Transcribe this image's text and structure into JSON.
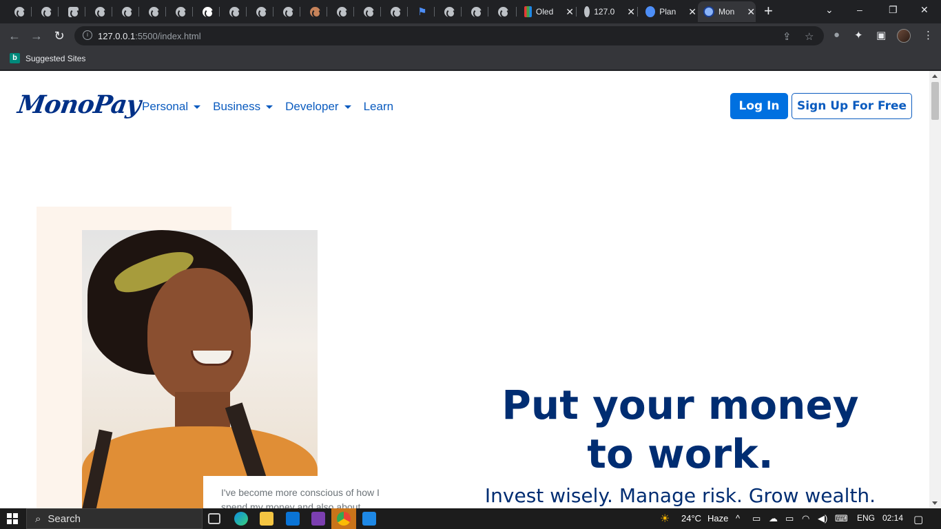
{
  "browser": {
    "tabs_wide": [
      {
        "label": "Oled",
        "close": "✕"
      },
      {
        "label": "127.0",
        "close": "✕"
      },
      {
        "label": "Plan",
        "close": "✕"
      },
      {
        "label": "Mon",
        "close": "✕",
        "active": true
      }
    ],
    "new_tab": "+",
    "window_controls": {
      "minimize": "–",
      "restore": "❐",
      "close": "✕",
      "tab_search": "⌄"
    },
    "url_host": "127.0.0.1",
    "url_path": ":5500/index.html",
    "bookmark": "Suggested Sites"
  },
  "site": {
    "logo": "MonoPay",
    "nav": [
      {
        "label": "Personal",
        "dropdown": true
      },
      {
        "label": "Business",
        "dropdown": true
      },
      {
        "label": "Developer",
        "dropdown": true
      },
      {
        "label": "Learn",
        "dropdown": false
      }
    ],
    "login_label": "Log In",
    "signup_label": "Sign Up For Free",
    "quote": "I've become more conscious of how I spend my money and also about",
    "hero_line1": "Put your money",
    "hero_line2": "to work.",
    "hero_sub": "Invest wisely. Manage risk. Grow wealth."
  },
  "taskbar": {
    "search_label": "Search",
    "weather": "24°C",
    "weather_desc": "Haze",
    "language": "ENG",
    "time": "02:14"
  },
  "colors": {
    "brand": "#003087",
    "accent": "#0070e0",
    "hero_text": "#002d72",
    "peach": "#fdf4ec"
  }
}
